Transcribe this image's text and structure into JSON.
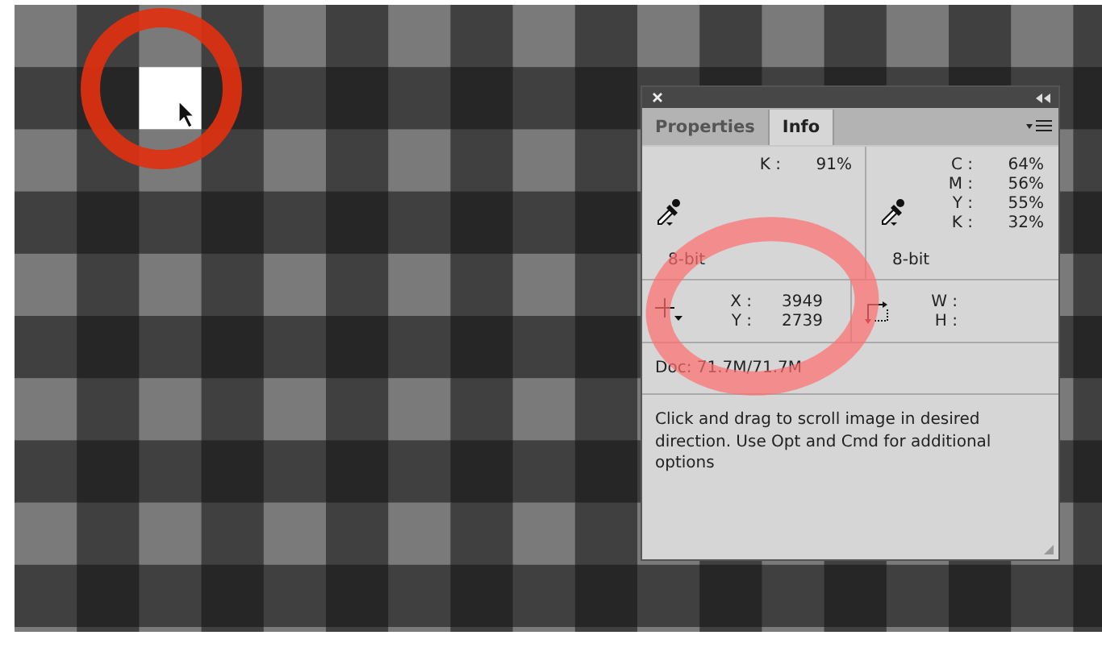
{
  "panel": {
    "tabs": [
      {
        "label": "Properties",
        "selected": false
      },
      {
        "label": "Info",
        "selected": true
      }
    ],
    "color_readouts": [
      {
        "channels": [
          {
            "label": "K :",
            "value": "91%"
          }
        ],
        "bit_depth": "8-bit"
      },
      {
        "channels": [
          {
            "label": "C :",
            "value": "64%"
          },
          {
            "label": "M :",
            "value": "56%"
          },
          {
            "label": "Y :",
            "value": "55%"
          },
          {
            "label": "K :",
            "value": "32%"
          }
        ],
        "bit_depth": "8-bit"
      }
    ],
    "position": [
      {
        "label": "X :",
        "value": "3949"
      },
      {
        "label": "Y :",
        "value": "2739"
      }
    ],
    "size": [
      {
        "label": "W :"
      },
      {
        "label": "H :"
      }
    ],
    "doc_size": "Doc: 71.7M/71.7M",
    "hint": "Click and drag to scroll image in desired direction.  Use Opt and Cmd for additional options"
  }
}
